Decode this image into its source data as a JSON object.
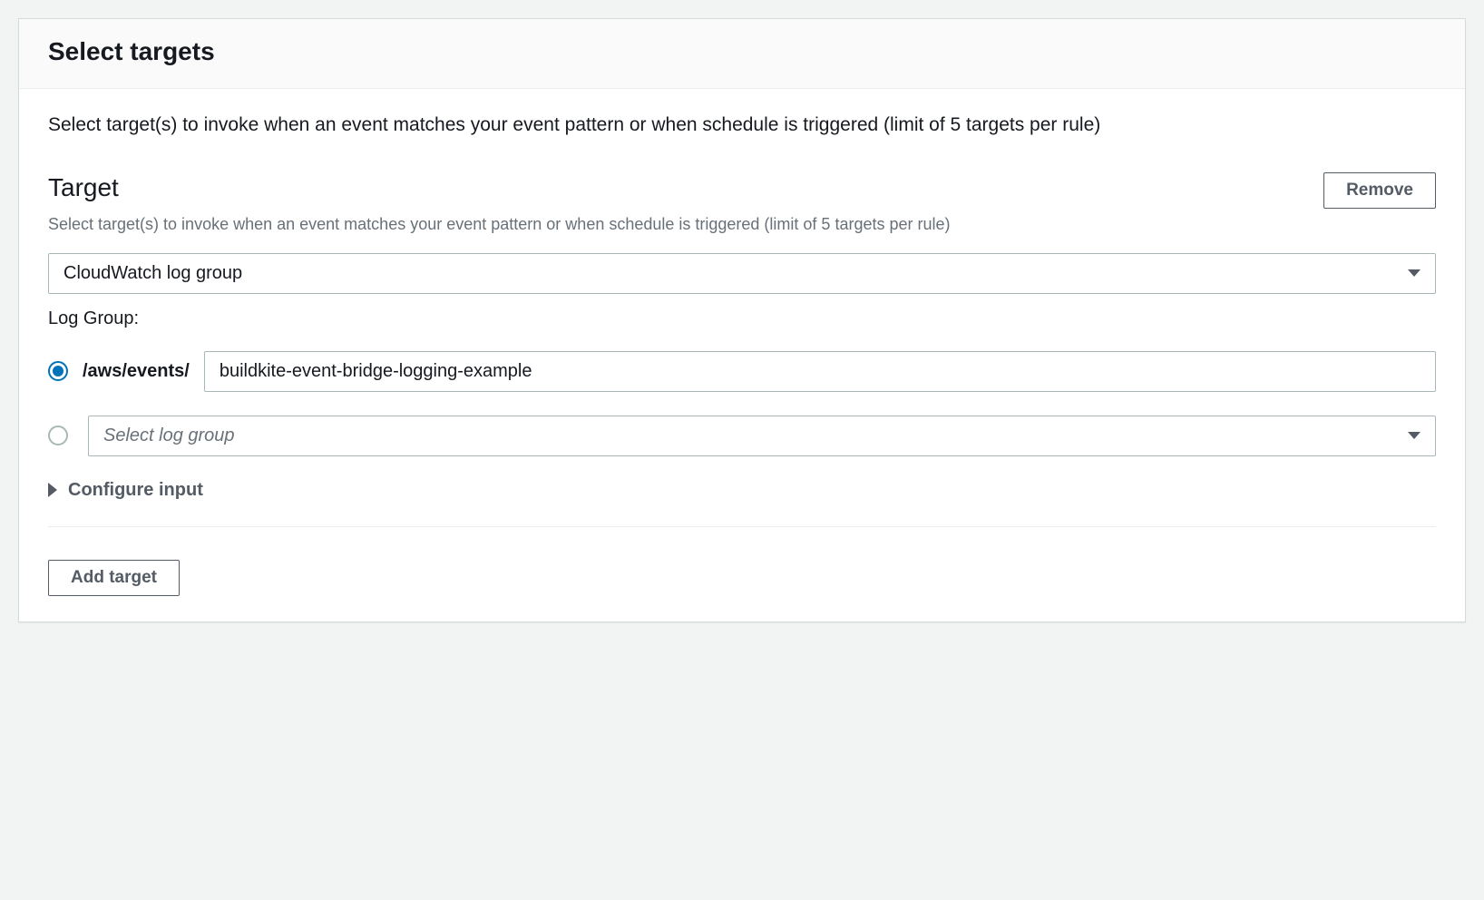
{
  "panel": {
    "title": "Select targets",
    "description": "Select target(s) to invoke when an event matches your event pattern or when schedule is triggered (limit of 5 targets per rule)"
  },
  "target": {
    "heading": "Target",
    "sub": "Select target(s) to invoke when an event matches your event pattern or when schedule is triggered (limit of 5 targets per rule)",
    "remove_label": "Remove",
    "type_select_value": "CloudWatch log group",
    "log_group_label": "Log Group:",
    "prefix": "/aws/events/",
    "input_value": "buildkite-event-bridge-logging-example",
    "existing_placeholder": "Select log group",
    "configure_input": "Configure input"
  },
  "footer": {
    "add_target_label": "Add target"
  }
}
